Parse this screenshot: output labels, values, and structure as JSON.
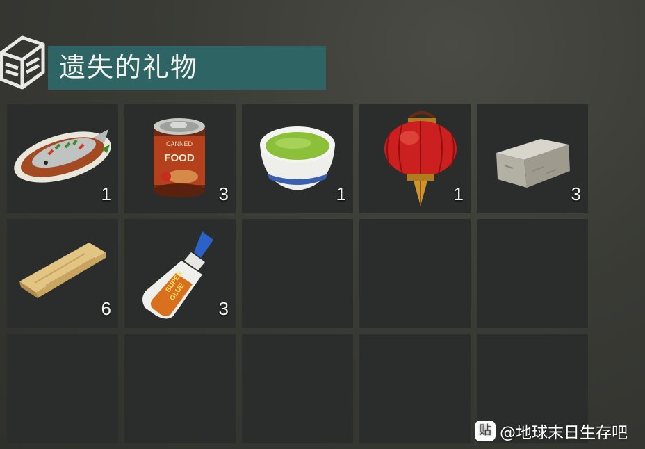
{
  "title": "遗失的礼物",
  "header_icon": "chest-icon",
  "slots": [
    {
      "icon": "steamed-fish-icon",
      "count": "1"
    },
    {
      "icon": "canned-food-icon",
      "count": "3",
      "can_label_top": "CANNED",
      "can_label": "FOOD"
    },
    {
      "icon": "green-tea-icon",
      "count": "1"
    },
    {
      "icon": "red-lantern-icon",
      "count": "1"
    },
    {
      "icon": "stone-block-icon",
      "count": "3"
    },
    {
      "icon": "wooden-plank-icon",
      "count": "6"
    },
    {
      "icon": "super-glue-icon",
      "count": "3",
      "glue_label_1": "SUPER",
      "glue_label_2": "GLUE"
    },
    {
      "icon": "",
      "count": ""
    },
    {
      "icon": "",
      "count": ""
    },
    {
      "icon": "",
      "count": ""
    },
    {
      "icon": "",
      "count": ""
    },
    {
      "icon": "",
      "count": ""
    },
    {
      "icon": "",
      "count": ""
    },
    {
      "icon": "",
      "count": ""
    },
    {
      "icon": "",
      "count": ""
    }
  ],
  "watermark": {
    "logo": "贴",
    "text": "@地球末日生存吧"
  },
  "colors": {
    "title_bar": "#2e6564",
    "slot": "#2a2d2b"
  }
}
